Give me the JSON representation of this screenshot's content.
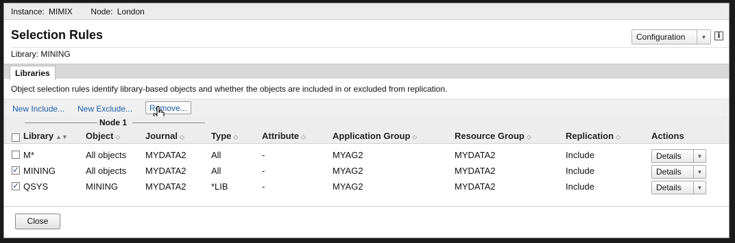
{
  "instance_bar": {
    "instance_label": "Instance:",
    "instance_value": "MIMIX",
    "node_label": "Node:",
    "node_value": "London"
  },
  "title": "Selection Rules",
  "config_select": {
    "value": "Configuration"
  },
  "library_line": {
    "label": "Library:",
    "value": "MINING"
  },
  "tabs": [
    {
      "label": "Libraries",
      "active": true
    }
  ],
  "description": "Object selection rules identify library-based objects and whether the objects are included in or excluded from replication.",
  "actions": {
    "new_include": "New Include...",
    "new_exclude": "New Exclude...",
    "remove": "Remove..."
  },
  "table": {
    "group_header": "Node 1",
    "columns": [
      "Library",
      "Object",
      "Journal",
      "Type",
      "Attribute",
      "Application Group",
      "Resource Group",
      "Replication",
      "Actions"
    ],
    "rows": [
      {
        "checked": false,
        "library": "M*",
        "object": "All objects",
        "journal": "MYDATA2",
        "type": "All",
        "attribute": "-",
        "app_group": "MYAG2",
        "resource_group": "MYDATA2",
        "replication": "Include",
        "action": "Details"
      },
      {
        "checked": true,
        "library": "MINING",
        "object": "All objects",
        "journal": "MYDATA2",
        "type": "All",
        "attribute": "-",
        "app_group": "MYAG2",
        "resource_group": "MYDATA2",
        "replication": "Include",
        "action": "Details"
      },
      {
        "checked": true,
        "library": "QSYS",
        "object": "MINING",
        "journal": "MYDATA2",
        "type": "*LIB",
        "attribute": "-",
        "app_group": "MYAG2",
        "resource_group": "MYDATA2",
        "replication": "Include",
        "action": "Details"
      }
    ]
  },
  "close_button": "Close",
  "colors": {
    "link": "#1f5fa8",
    "header_band": "#ededed",
    "tab_bar": "#d8d8d8"
  }
}
